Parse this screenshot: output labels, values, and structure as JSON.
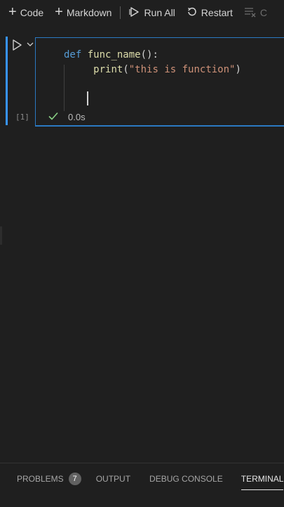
{
  "toolbar": {
    "code_label": "Code",
    "markdown_label": "Markdown",
    "run_all_label": "Run All",
    "restart_label": "Restart",
    "clipped_label": "C"
  },
  "cell": {
    "execution_count": "[1]",
    "status_time": "0.0s",
    "code": {
      "line1_kw": "def",
      "line1_fn": "func_name",
      "line1_rest": "():",
      "line2_fn": "print",
      "line2_open": "(",
      "line2_str": "\"this is function\"",
      "line2_close": ")"
    }
  },
  "panel": {
    "tabs": [
      {
        "label": "PROBLEMS",
        "badge": "7"
      },
      {
        "label": "OUTPUT"
      },
      {
        "label": "DEBUG CONSOLE"
      },
      {
        "label": "TERMINAL",
        "active": true
      }
    ]
  },
  "colors": {
    "accent": "#3794ff",
    "keyword": "#569cd6",
    "function": "#dcdcaa",
    "string": "#ce9178",
    "success": "#89d185"
  }
}
